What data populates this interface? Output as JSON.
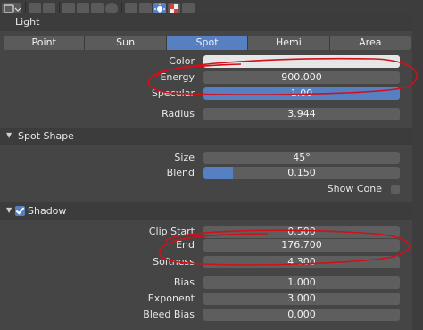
{
  "toolbar": {
    "icons": [
      "editor-type-icon",
      "chevron-down-icon",
      "render-icon",
      "render-layers-icon",
      "scene-icon",
      "world-icon",
      "object-icon",
      "constraints-icon",
      "modifiers-icon",
      "data-icon",
      "material-icon",
      "light-data-icon"
    ],
    "active_icon": "light-data-icon"
  },
  "light_panel": {
    "title": "Light",
    "types": [
      "Point",
      "Sun",
      "Spot",
      "Hemi",
      "Area"
    ],
    "active_type": "Spot",
    "color": {
      "label": "Color",
      "swatch": "#e6e6e6"
    },
    "energy": {
      "label": "Energy",
      "value": "900.000"
    },
    "specular": {
      "label": "Specular",
      "value": "1.00"
    },
    "radius": {
      "label": "Radius",
      "value": "3.944"
    }
  },
  "spot_shape": {
    "title": "Spot Shape",
    "size": {
      "label": "Size",
      "value": "45°"
    },
    "blend": {
      "label": "Blend",
      "value": "0.150",
      "fraction": 0.15
    },
    "show_cone": {
      "label": "Show Cone",
      "checked": false
    }
  },
  "shadow": {
    "title": "Shadow",
    "enabled": true,
    "clip_start": {
      "label": "Clip Start",
      "value": "0.500"
    },
    "end": {
      "label": "End",
      "value": "176.700"
    },
    "softness": {
      "label": "Softness",
      "value": "4.300"
    },
    "bias": {
      "label": "Bias",
      "value": "1.000"
    },
    "exponent": {
      "label": "Exponent",
      "value": "3.000"
    },
    "bleed_bias": {
      "label": "Bleed Bias",
      "value": "0.000"
    }
  },
  "colors": {
    "accent": "#5680c2",
    "annotation": "#d0101a"
  }
}
